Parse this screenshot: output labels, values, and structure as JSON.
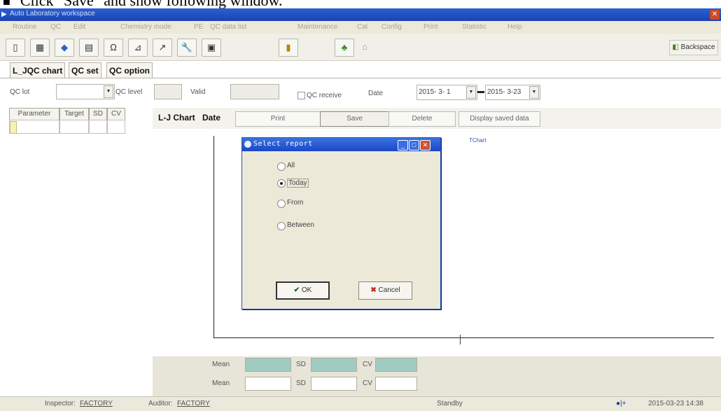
{
  "caption": {
    "bullet": "■",
    "text": "Click \"Save\" and show following window."
  },
  "window": {
    "title": "Auto Laboratory workspace",
    "close_glyph": "✕"
  },
  "menu": [
    "Routine",
    "QC",
    "Edit",
    "Chemistry mode",
    "PE",
    "QC data list",
    "Maintenance",
    "Cal",
    "Config",
    "Print",
    "Statistic",
    "Help"
  ],
  "toolbar": {
    "icons": [
      "folder-icon",
      "grid-icon",
      "diamond-icon",
      "table-icon",
      "omega-icon",
      "chart-icon",
      "cursor-icon",
      "wrench-icon",
      "printer-icon",
      "door-icon",
      "plant-icon",
      "mouse-icon"
    ],
    "backspace_label": "Backspace"
  },
  "tabs": [
    "L_JQC chart",
    "QC set",
    "QC option"
  ],
  "filters": {
    "qc_lot_label": "QC lot",
    "qc_level_label": "QC level",
    "valid_label": "Valid",
    "qc_receive_label": "QC receive",
    "date_label": "Date",
    "date_from": "2015- 3- 1",
    "date_to": "2015- 3-23"
  },
  "left_table": {
    "columns": [
      "Parameter",
      "Target",
      "SD",
      "CV"
    ]
  },
  "chart_header": {
    "lj_chart_label": "L-J Chart",
    "date_label": "Date",
    "print_label": "Print",
    "save_label": "Save",
    "delete_label": "Delete",
    "display_saved_label": "Display saved data",
    "chart_title": "TChart"
  },
  "stats": {
    "mean_label": "Mean",
    "sd_label": "SD",
    "cv_label": "CV"
  },
  "dialog": {
    "title": "Select report",
    "options": [
      "All",
      "Today",
      "From",
      "Between"
    ],
    "selected": "Today",
    "ok_label": "OK",
    "cancel_label": "Cancel"
  },
  "statusbar": {
    "inspector_label": "Inspector:",
    "inspector": "FACTORY",
    "auditor_label": "Auditor:",
    "auditor": "FACTORY",
    "status": "Standby",
    "datetime": "2015-03-23 14:38"
  },
  "colors": {
    "title_blue": "#1a47c6",
    "stat_fill": "#9fcbc0",
    "panel": "#ece9d8"
  }
}
